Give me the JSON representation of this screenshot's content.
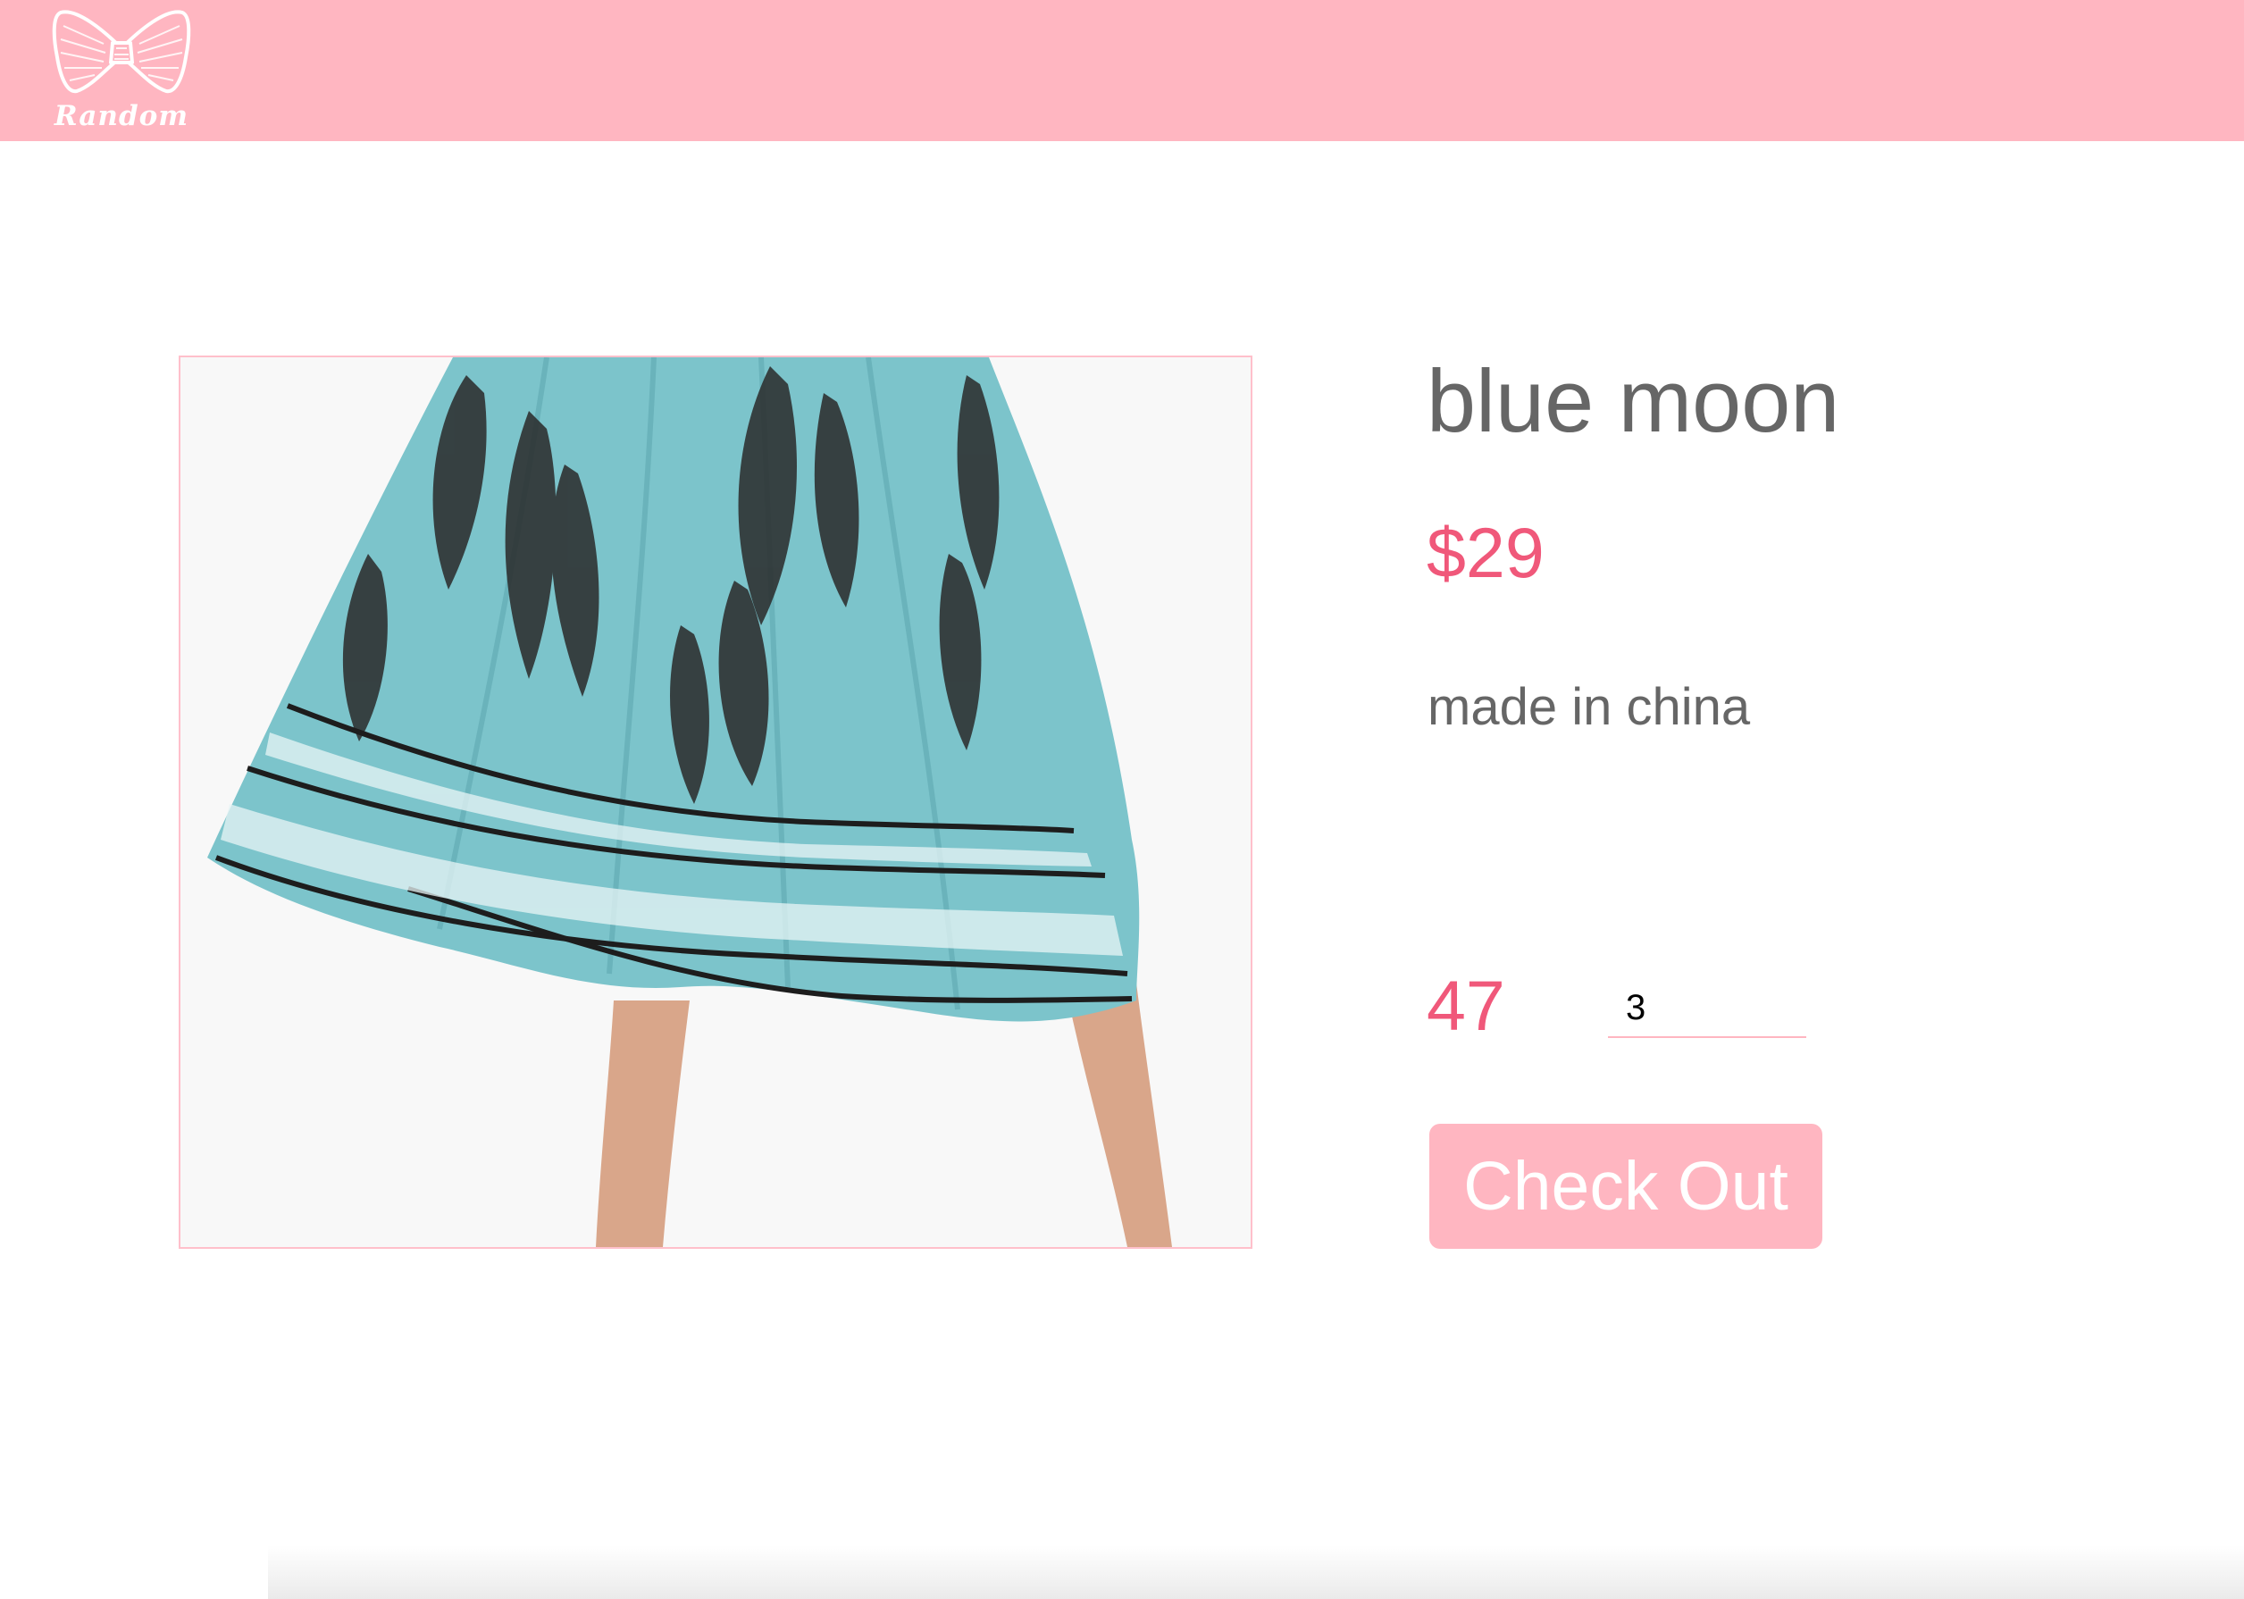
{
  "header": {
    "logo_text": "Random",
    "logo_icon": "bow-tie-icon",
    "background_color": "#ffb6c1"
  },
  "product": {
    "image_icon": "dress-photo",
    "title": "blue moon",
    "price": "$29",
    "origin": "made in china",
    "stock": "47",
    "quantity_value": "3",
    "checkout_label": "Check Out"
  },
  "colors": {
    "accent": "#f0587a",
    "button": "#ffb6c1",
    "text": "#666666"
  }
}
